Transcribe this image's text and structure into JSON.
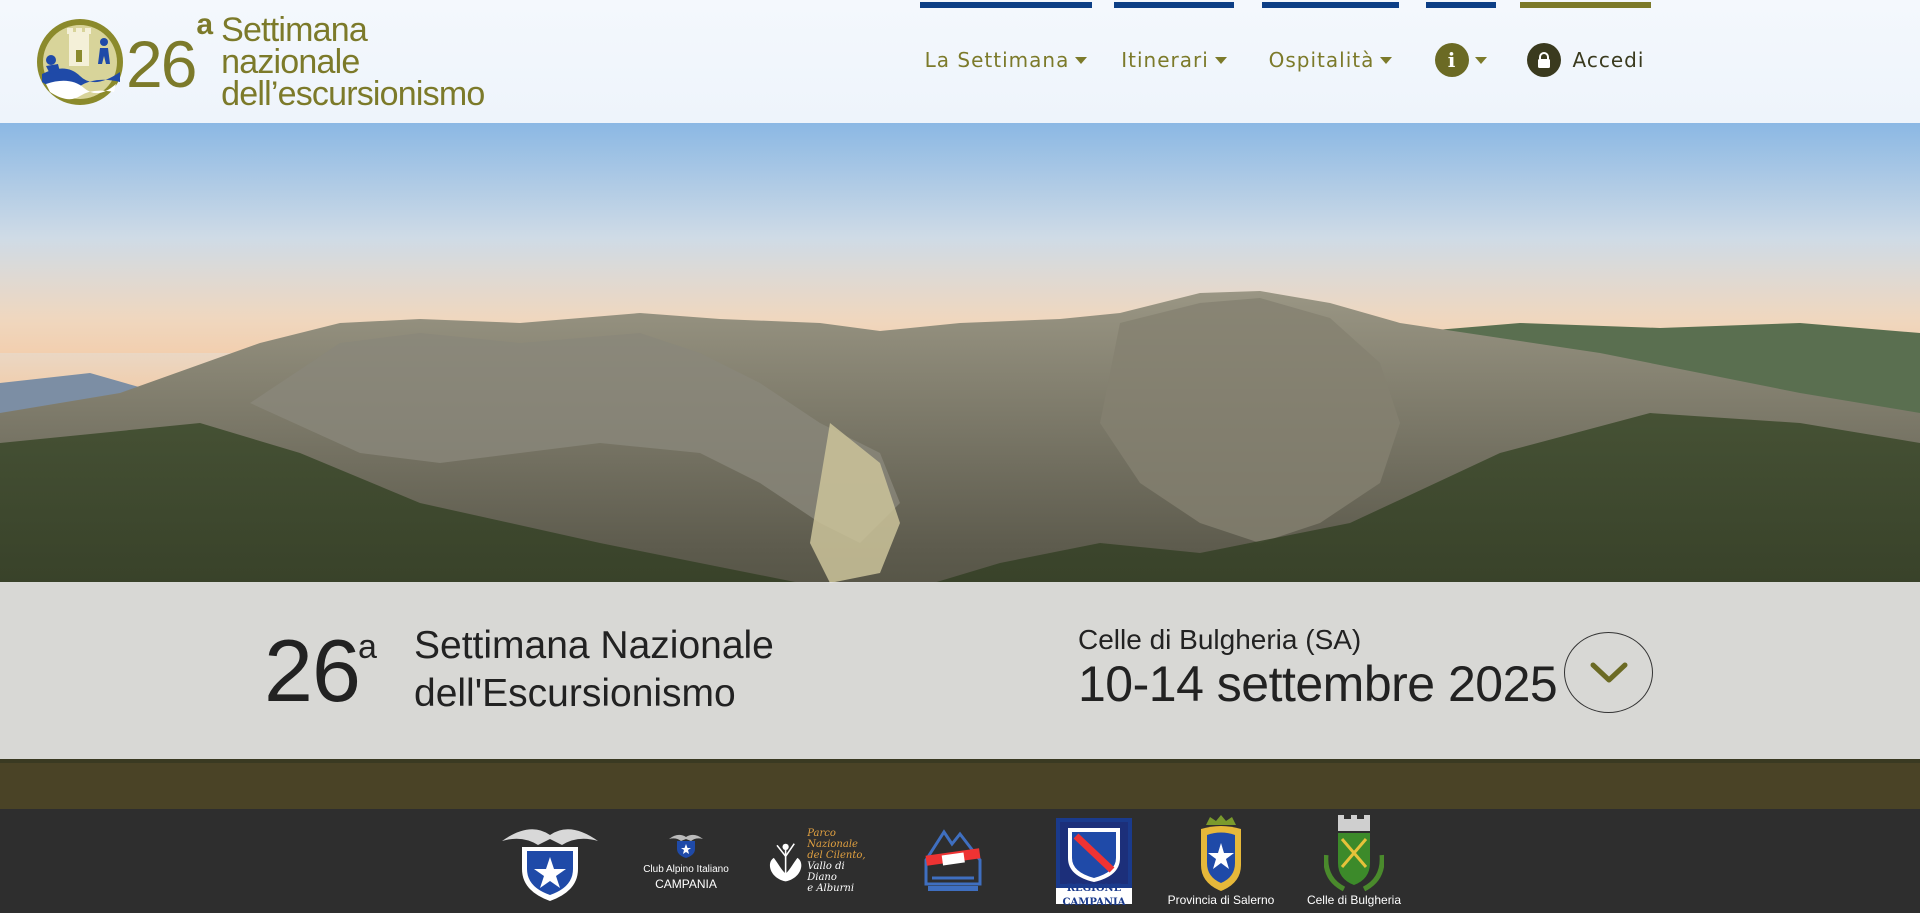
{
  "logo": {
    "number": "26",
    "number_sup": "a",
    "line1": "Settimana nazionale",
    "line2": "dell’escursionismo"
  },
  "nav": {
    "items": [
      {
        "label": "La Settimana",
        "has_dropdown": true
      },
      {
        "label": "Itinerari",
        "has_dropdown": true
      },
      {
        "label": "Ospitalità",
        "has_dropdown": true
      },
      {
        "label": "",
        "icon": "info-icon",
        "has_dropdown": true
      },
      {
        "label": "Accedi",
        "icon": "lock-icon",
        "has_dropdown": false
      }
    ]
  },
  "event": {
    "number": "26",
    "number_sup": "a",
    "title_line1": "Settimana Nazionale",
    "title_line2": "dell'Escursionismo",
    "place": "Celle di Bulgheria (SA)",
    "dates": "10-14 settembre 2025"
  },
  "sponsors": {
    "cai_campania_line1": "Club Alpino Italiano",
    "cai_campania_line2": "CAMPANIA",
    "parco_line1": "Parco Nazionale",
    "parco_line2": "del Cilento,",
    "parco_line3": "Vallo di Diano",
    "parco_line4": "e Alburni",
    "regione_label": "REGIONE CAMPANIA",
    "provincia_label": "Provincia di Salerno",
    "comune_label": "Celle di Bulgheria"
  },
  "colors": {
    "olive": "#7c7a2a",
    "navy_bar": "#0d3f86",
    "footer_bg": "#2e2e2e"
  }
}
